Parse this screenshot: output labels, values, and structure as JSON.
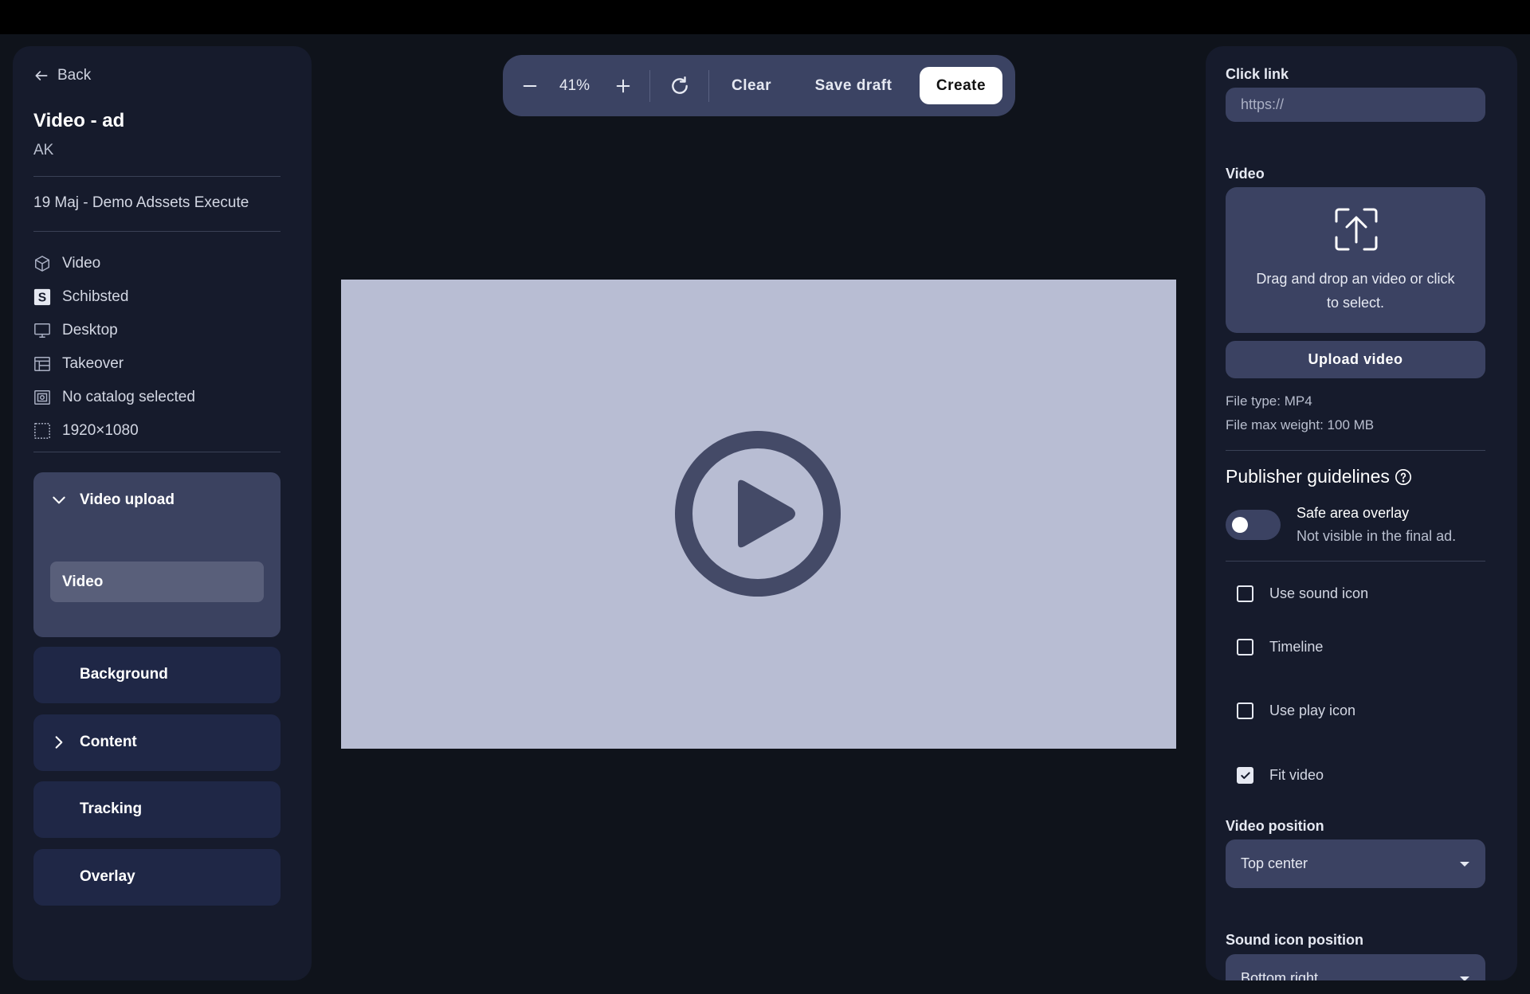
{
  "left": {
    "back_label": "Back",
    "title": "Video - ad",
    "subtitle": "AK",
    "campaign": "19 Maj - Demo Adssets Execute",
    "meta": [
      {
        "icon": "cube-icon",
        "label": "Video"
      },
      {
        "icon": "schibsted-logo-icon",
        "label": "Schibsted"
      },
      {
        "icon": "monitor-icon",
        "label": "Desktop"
      },
      {
        "icon": "layout-table-icon",
        "label": "Takeover"
      },
      {
        "icon": "catalog-icon",
        "label": "No catalog selected"
      },
      {
        "icon": "dashed-square-icon",
        "label": "1920×1080"
      }
    ],
    "sections": {
      "video_upload": {
        "label": "Video upload",
        "sub_item": "Video"
      },
      "background": {
        "label": "Background"
      },
      "content": {
        "label": "Content"
      },
      "tracking": {
        "label": "Tracking"
      },
      "overlay": {
        "label": "Overlay"
      }
    }
  },
  "toolbar": {
    "zoom": "41%",
    "clear_label": "Clear",
    "save_draft_label": "Save draft",
    "create_label": "Create"
  },
  "right": {
    "click_link_label": "Click link",
    "click_link_placeholder": "https://",
    "video_label": "Video",
    "drop_text": "Drag and drop an video or click to select.",
    "upload_label": "Upload video",
    "file_type": "File type: MP4",
    "file_max": "File max weight: 100 MB",
    "publisher_guidelines": "Publisher guidelines",
    "safe_area_title": "Safe area overlay",
    "safe_area_sub": "Not visible in the final ad.",
    "safe_area_on": false,
    "checkboxes": [
      {
        "label": "Use sound icon",
        "checked": false
      },
      {
        "label": "Timeline",
        "checked": false
      },
      {
        "label": "Use play icon",
        "checked": false
      },
      {
        "label": "Fit video",
        "checked": true
      }
    ],
    "video_position_label": "Video position",
    "video_position_value": "Top center",
    "sound_icon_position_label": "Sound icon position",
    "sound_icon_position_value": "Bottom right"
  },
  "colors": {
    "background": "#0f131b",
    "panel": "#161b2c",
    "section": "#1f2746",
    "accent_control": "#3b4262",
    "canvas": "#b8bdd3",
    "play_icon": "#444a67"
  }
}
